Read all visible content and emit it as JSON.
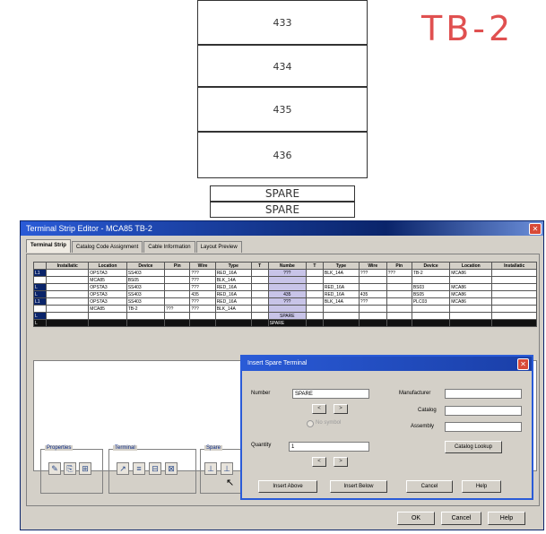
{
  "drawing": {
    "terminal_numbers": [
      "433",
      "434",
      "435",
      "436"
    ],
    "spares": [
      "SPARE",
      "SPARE"
    ],
    "strip_label": "TB-2"
  },
  "dialog": {
    "title": "Terminal Strip Editor - MCA85 TB-2",
    "tabs": [
      "Terminal Strip",
      "Catalog Code Assignment",
      "Cable Information",
      "Layout Preview"
    ],
    "grid": {
      "headers": [
        "",
        "Installatic",
        "Location",
        "Device",
        "Pin",
        "Wire",
        "Type",
        "T",
        "Numbe",
        "T",
        "Type",
        "Wire",
        "Pin",
        "Device",
        "Location",
        "Installatic"
      ],
      "rows": [
        [
          "L1",
          "",
          "OPSTA3",
          "SS403",
          "",
          "???",
          "RED_16A",
          "",
          "???",
          "",
          "BLK_14A",
          "???",
          "???",
          "TB-2",
          "MCA86",
          ""
        ],
        [
          "",
          "",
          "MCA85",
          "BS05",
          "",
          "???",
          "BLK_14A",
          "",
          "",
          "",
          "",
          "",
          "",
          "",
          "",
          ""
        ],
        [
          "L",
          "",
          "OPSTA3",
          "SS403",
          "",
          "???",
          "RED_16A",
          "",
          "",
          "",
          "RED_16A",
          "",
          "",
          "BS03",
          "MCA86",
          ""
        ],
        [
          "L",
          "",
          "OPSTA3",
          "SS403",
          "",
          "435",
          "RED_16A",
          "",
          "435",
          "",
          "RED_16A",
          "435",
          "",
          "BS05",
          "MCA86",
          ""
        ],
        [
          "L1",
          "",
          "OPSTA3",
          "SS403",
          "",
          "???",
          "RED_16A",
          "",
          "???",
          "",
          "BLK_14A",
          "???",
          "",
          "PLC03",
          "MCA86",
          ""
        ],
        [
          "",
          "",
          "MCA85",
          "TB-2",
          "???",
          "???",
          "BLK_14A",
          "",
          "",
          "",
          "",
          "",
          "",
          "",
          "",
          ""
        ],
        [
          "L",
          "",
          "",
          "",
          "",
          "",
          "",
          "",
          "SPARE",
          "",
          "",
          "",
          "",
          "",
          "",
          ""
        ],
        [
          "L",
          "",
          "",
          "",
          "",
          "",
          "",
          "",
          "SPARE",
          "",
          "",
          "",
          "",
          "",
          "",
          ""
        ]
      ]
    },
    "groups": {
      "properties": "Properties",
      "terminal": "Terminal",
      "spare": "Spare"
    },
    "buttons": {
      "ok": "OK",
      "cancel": "Cancel",
      "help": "Help"
    }
  },
  "insert_spare": {
    "title": "Insert Spare Terminal",
    "number_label": "Number",
    "number_value": "SPARE",
    "no_symbol_label": "No symbol",
    "quantity_label": "Quantity",
    "quantity_value": "1",
    "manufacturer_label": "Manufacturer",
    "catalog_label": "Catalog",
    "assembly_label": "Assembly",
    "catalog_lookup": "Catalog Lookup",
    "insert_above": "Insert Above",
    "insert_below": "Insert Below",
    "cancel": "Cancel",
    "help": "Help",
    "prev_arrow": "<",
    "next_arrow": ">"
  }
}
